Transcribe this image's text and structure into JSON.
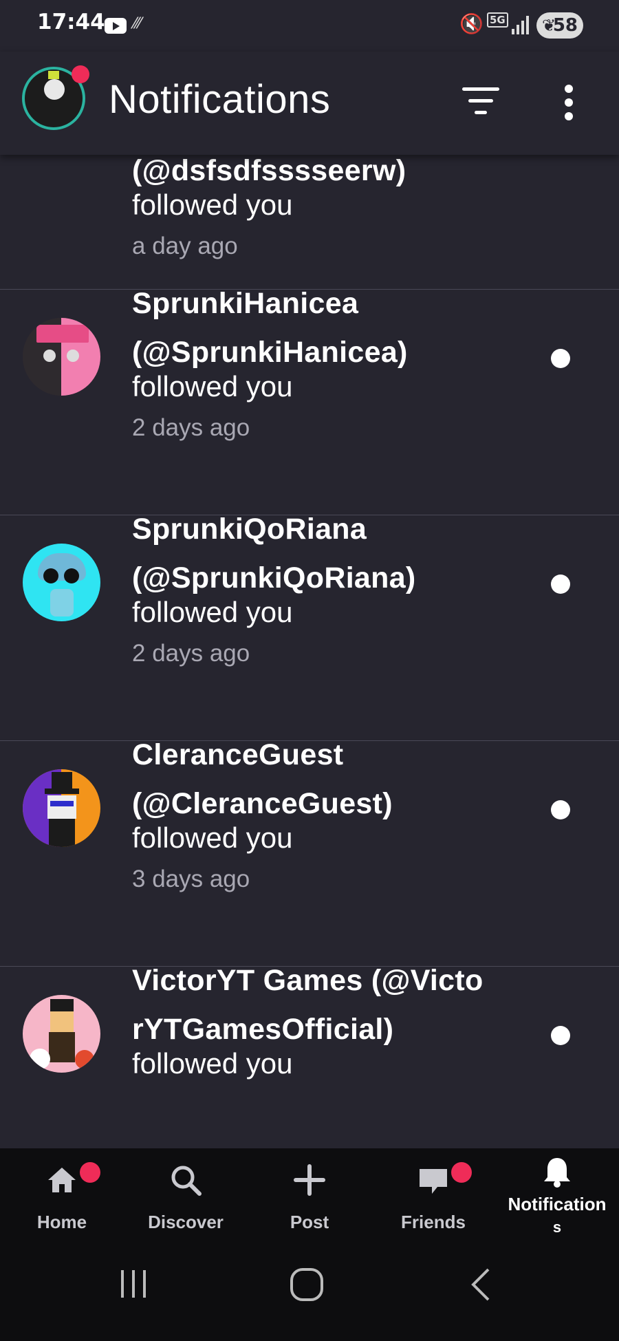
{
  "status_bar": {
    "time": "17:44",
    "network": "5G",
    "battery": "58"
  },
  "app_bar": {
    "title": "Notifications"
  },
  "notifications": [
    {
      "name_line1": "",
      "name_line2": "(@dsfsdfsssseerw)",
      "action": "followed you",
      "time": "a day ago"
    },
    {
      "name_line1": "SprunkiHanicea",
      "name_line2": "(@SprunkiHanicea)",
      "action": "followed you",
      "time": "2 days ago"
    },
    {
      "name_line1": "SprunkiQoRiana",
      "name_line2": "(@SprunkiQoRiana)",
      "action": "followed you",
      "time": "2 days ago"
    },
    {
      "name_line1": "CleranceGuest",
      "name_line2": "(@CleranceGuest)",
      "action": "followed you",
      "time": "3 days ago"
    },
    {
      "name_line1": "VictorYT Games (@Victo",
      "name_line2": "rYTGamesOfficial)",
      "action": "followed you",
      "time": ""
    }
  ],
  "bottom_nav": {
    "home": "Home",
    "discover": "Discover",
    "post": "Post",
    "friends": "Friends",
    "notifications_line1": "Notification",
    "notifications_line2": "s"
  },
  "colors": {
    "background": "#26252f",
    "badge": "#ef2c58",
    "nav_background": "#0d0d0f",
    "muted_text": "#a9a8b3"
  }
}
